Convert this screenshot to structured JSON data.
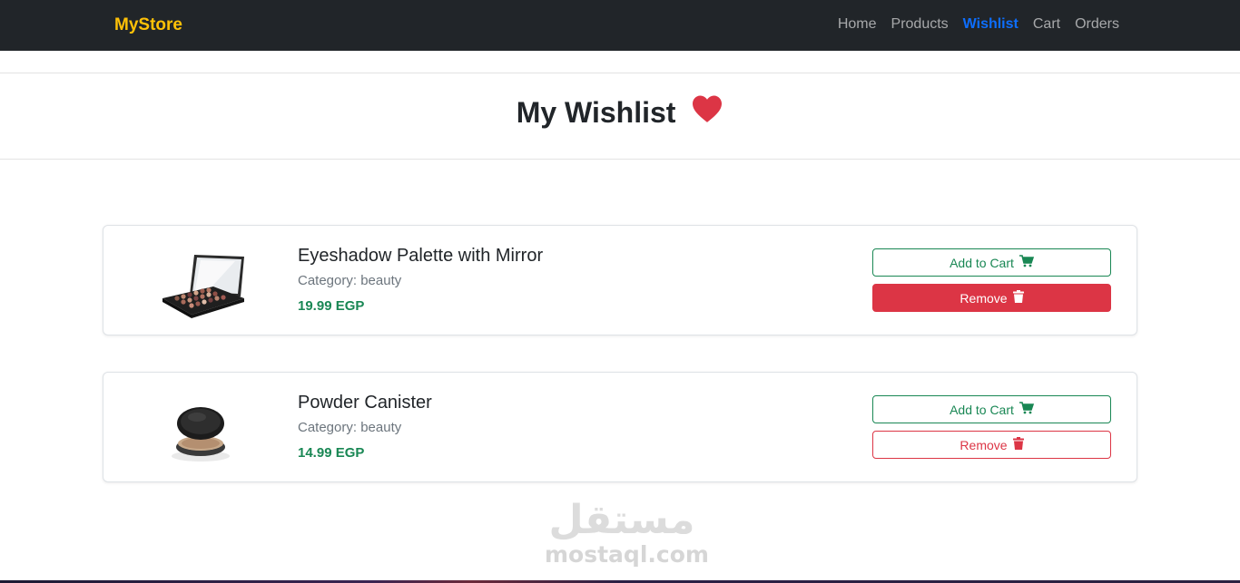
{
  "navbar": {
    "brand": "MyStore",
    "links": [
      "Home",
      "Products",
      "Wishlist",
      "Cart",
      "Orders"
    ],
    "active": "Wishlist"
  },
  "page": {
    "title": "My Wishlist",
    "title_icon": "heart-icon"
  },
  "items": [
    {
      "name": "Eyeshadow Palette with Mirror",
      "category_label": "Category:",
      "category": "beauty",
      "price": "19.99 EGP",
      "image": "eyeshadow-palette-image",
      "add_to_cart_label": "Add to Cart",
      "remove_label": "Remove"
    },
    {
      "name": "Powder Canister",
      "category_label": "Category:",
      "category": "beauty",
      "price": "14.99 EGP",
      "image": "powder-canister-image",
      "add_to_cart_label": "Add to Cart",
      "remove_label": "Remove"
    }
  ],
  "watermark": {
    "arabic": "مستقل",
    "latin": "mostaql.com"
  },
  "colors": {
    "navbar_bg": "#212529",
    "brand": "#ffc107",
    "active_link": "#0d6efd",
    "price": "#198754",
    "danger": "#dc3545",
    "heart": "#dc3545"
  }
}
